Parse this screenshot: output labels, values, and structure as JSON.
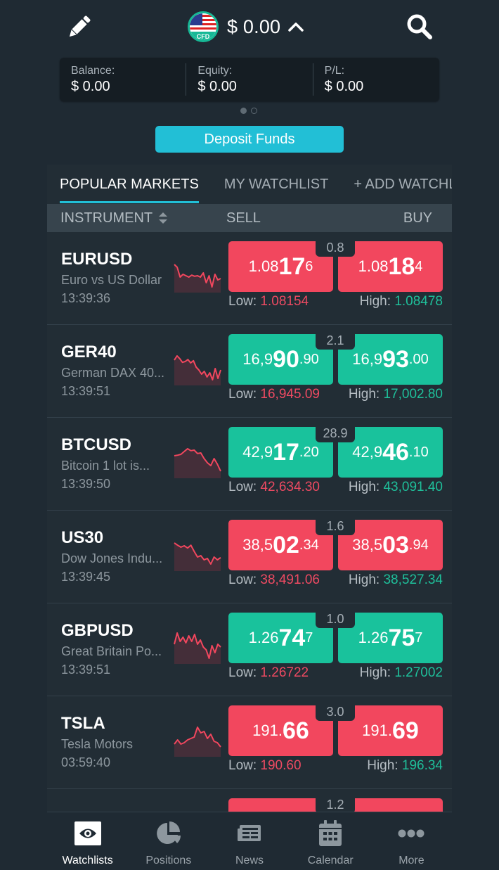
{
  "header": {
    "account_amount": "$ 0.00",
    "account_badge": "CFD"
  },
  "summary": {
    "balance_label": "Balance:",
    "balance_value": "$ 0.00",
    "equity_label": "Equity:",
    "equity_value": "$ 0.00",
    "pl_label": "P/L:",
    "pl_value": "$ 0.00",
    "page_index": 1,
    "page_count": 2
  },
  "deposit_label": "Deposit Funds",
  "tabs": [
    {
      "label": "POPULAR MARKETS",
      "active": true
    },
    {
      "label": "MY WATCHLIST",
      "active": false
    },
    {
      "label": "+ ADD WATCHLIST",
      "active": false
    }
  ],
  "table_header": {
    "instrument": "INSTRUMENT",
    "sell": "SELL",
    "buy": "BUY"
  },
  "labels": {
    "low": "Low:",
    "high": "High:"
  },
  "colors": {
    "down": "#f2475e",
    "up": "#19c29c",
    "accent": "#22bfd6",
    "low_text": "#ee4a62",
    "high_text": "#1fbf9a"
  },
  "instruments": [
    {
      "symbol": "EURUSD",
      "description": "Euro vs US Dollar",
      "time": "13:39:36",
      "direction": "down",
      "spread": "0.8",
      "sell": {
        "prefix": "1.08",
        "big": "17",
        "tail": "6"
      },
      "buy": {
        "prefix": "1.08",
        "big": "18",
        "tail": "4"
      },
      "low": "1.08154",
      "high": "1.08478",
      "spark": [
        0.9,
        0.8,
        0.45,
        0.55,
        0.5,
        0.45,
        0.52,
        0.48,
        0.5,
        0.45,
        0.6,
        0.25,
        0.5,
        0.1,
        0.55,
        0.35,
        0.4
      ]
    },
    {
      "symbol": "GER40",
      "description": "German DAX 40...",
      "time": "13:39:51",
      "direction": "up",
      "spread": "2.1",
      "sell": {
        "prefix": "16,9",
        "big": "90",
        "tail": ".90"
      },
      "buy": {
        "prefix": "16,9",
        "big": "93",
        "tail": ".00"
      },
      "low": "16,945.09",
      "high": "17,002.80",
      "spark": [
        0.8,
        0.95,
        0.85,
        0.72,
        0.75,
        0.82,
        0.7,
        0.78,
        0.55,
        0.45,
        0.3,
        0.4,
        0.2,
        0.35,
        0.1,
        0.5,
        0.15,
        0.45
      ]
    },
    {
      "symbol": "BTCUSD",
      "description": "Bitcoin 1 lot  is...",
      "time": "13:39:50",
      "direction": "up",
      "spread": "28.9",
      "sell": {
        "prefix": "42,9",
        "big": "17",
        "tail": ".20"
      },
      "buy": {
        "prefix": "42,9",
        "big": "46",
        "tail": ".10"
      },
      "low": "42,634.30",
      "high": "43,091.40",
      "spark": [
        0.7,
        0.72,
        0.75,
        0.85,
        0.95,
        0.88,
        0.9,
        0.78,
        0.8,
        0.6,
        0.45,
        0.35,
        0.6,
        0.4,
        0.15
      ]
    },
    {
      "symbol": "US30",
      "description": "Dow Jones Indu...",
      "time": "13:39:45",
      "direction": "down",
      "spread": "1.6",
      "sell": {
        "prefix": "38,5",
        "big": "02",
        "tail": ".34"
      },
      "buy": {
        "prefix": "38,5",
        "big": "03",
        "tail": ".94"
      },
      "low": "38,491.06",
      "high": "38,527.34",
      "spark": [
        0.9,
        0.82,
        0.75,
        0.8,
        0.72,
        0.82,
        0.6,
        0.4,
        0.45,
        0.3,
        0.35,
        0.15,
        0.4,
        0.3,
        0.38
      ]
    },
    {
      "symbol": "GBPUSD",
      "description": "Great Britain Po...",
      "time": "13:39:51",
      "direction": "up",
      "spread": "1.0",
      "sell": {
        "prefix": "1.26",
        "big": "74",
        "tail": "7"
      },
      "buy": {
        "prefix": "1.26",
        "big": "75",
        "tail": "7"
      },
      "low": "1.26722",
      "high": "1.27002",
      "spark": [
        0.6,
        1.0,
        0.7,
        0.85,
        0.65,
        0.9,
        0.7,
        0.95,
        0.6,
        0.75,
        0.5,
        0.4,
        0.1,
        0.55,
        0.3,
        0.6,
        0.5
      ]
    },
    {
      "symbol": "TSLA",
      "description": "Tesla Motors",
      "time": "03:59:40",
      "direction": "down",
      "spread": "3.0",
      "sell": {
        "prefix": "191.",
        "big": "66",
        "tail": ""
      },
      "buy": {
        "prefix": "191.",
        "big": "69",
        "tail": ""
      },
      "low": "190.60",
      "high": "196.34",
      "spark": [
        0.35,
        0.5,
        0.35,
        0.4,
        0.5,
        0.55,
        0.6,
        0.95,
        0.75,
        0.8,
        0.55,
        0.7,
        0.45,
        0.4,
        0.25
      ]
    }
  ],
  "partial_row": {
    "spread": "1.2",
    "direction": "down"
  },
  "bottom_nav": [
    {
      "label": "Watchlists",
      "icon": "eye-icon",
      "active": true
    },
    {
      "label": "Positions",
      "icon": "pie-chart-icon",
      "active": false
    },
    {
      "label": "News",
      "icon": "newspaper-icon",
      "active": false
    },
    {
      "label": "Calendar",
      "icon": "calendar-icon",
      "active": false
    },
    {
      "label": "More",
      "icon": "more-dots-icon",
      "active": false
    }
  ]
}
